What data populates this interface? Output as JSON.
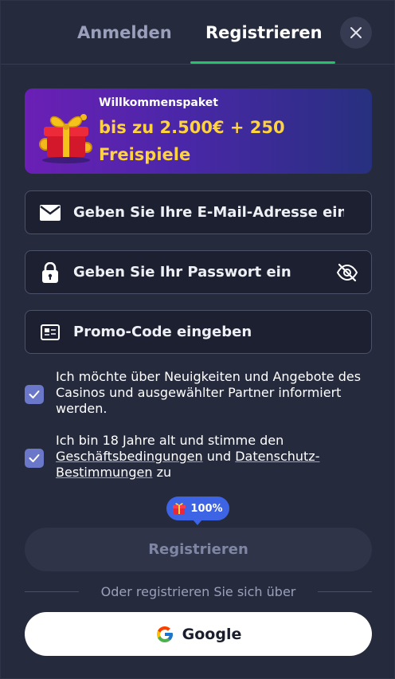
{
  "tabs": {
    "login": "Anmelden",
    "register": "Registrieren"
  },
  "banner": {
    "subtitle": "Willkommenspaket",
    "title": "bis zu 2.500€ + 250 Freispiele"
  },
  "form": {
    "email_placeholder": "Geben Sie Ihre E-Mail-Adresse ein",
    "password_placeholder": "Geben Sie Ihr Passwort ein",
    "promo_placeholder": "Promo-Code eingeben"
  },
  "checks": {
    "newsletter": {
      "checked": true,
      "text": "Ich möchte über Neuigkeiten und Angebote des Casinos und ausgewählter Partner informiert werden."
    },
    "terms": {
      "checked": true,
      "prefix": "Ich bin 18 Jahre alt und stimme den",
      "terms_link": "Geschäftsbedingungen",
      "and": "und",
      "privacy_link": "Datenschutz-Bestimmungen",
      "suffix": "zu"
    }
  },
  "badge": {
    "text": "100%",
    "icon": "gift-icon"
  },
  "register_button": "Registrieren",
  "divider_text": "Oder registrieren Sie sich über",
  "google_button": "Google",
  "colors": {
    "background": "#252a3d",
    "accent_green": "#25c26a",
    "banner_title": "#ffd240",
    "checkbox": "#6b77c8",
    "badge": "#3e64e6"
  }
}
